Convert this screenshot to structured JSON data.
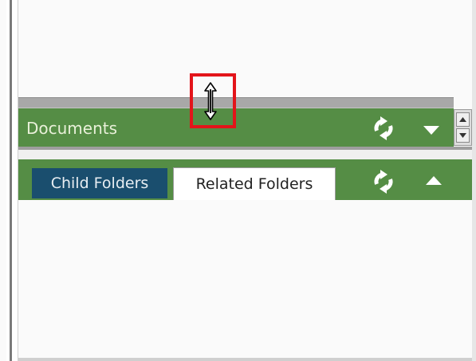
{
  "documents_panel": {
    "title": "Documents",
    "refresh_icon": "refresh-icon",
    "collapse_icon": "chevron-down-icon"
  },
  "folders_panel": {
    "tabs": [
      {
        "label": "Child Folders",
        "selected": false
      },
      {
        "label": "Related Folders",
        "selected": true
      }
    ],
    "refresh_icon": "refresh-icon",
    "expand_icon": "chevron-up-icon"
  },
  "scroll_icons": [
    "arrow-up-icon",
    "arrow-down-icon"
  ],
  "cursor_icon": "resize-vertical-cursor-icon",
  "colors": {
    "panel_green": "#558d45",
    "header_text": "#e9f0d9",
    "tab_dark_teal": "#1a4e6e",
    "highlight_red": "#e3141a",
    "splitter_gray": "#a8a8a8"
  }
}
